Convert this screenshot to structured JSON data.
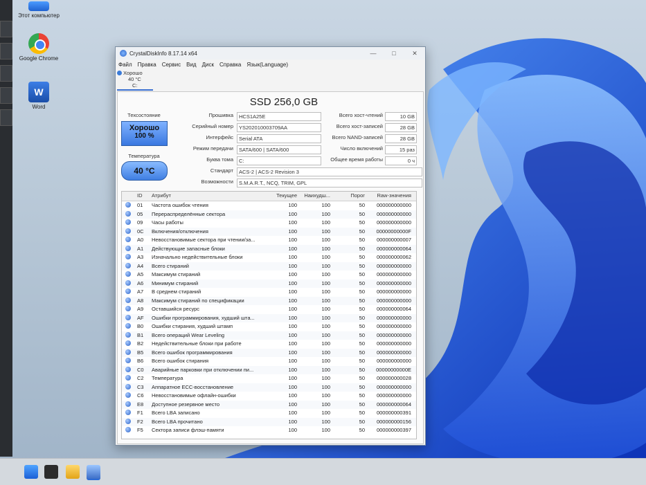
{
  "desktop": {
    "icons": [
      {
        "label": "Этот компьютер"
      },
      {
        "label": "Google Chrome"
      },
      {
        "label": "Word"
      }
    ]
  },
  "window": {
    "title": "CrystalDiskInfo 8.17.14 x64",
    "menu": [
      "Файл",
      "Правка",
      "Сервис",
      "Вид",
      "Диск",
      "Справка",
      "Язык(Language)"
    ],
    "disk_tab": {
      "status": "Хорошо",
      "temp": "40 °C",
      "letter": "C:"
    },
    "model": "SSD 256,0 GB",
    "health": {
      "caption": "Техсостояние",
      "status": "Хорошо",
      "percent": "100 %"
    },
    "temperature": {
      "caption": "Температура",
      "value": "40 °C"
    },
    "info": [
      {
        "label": "Прошивка",
        "value": "HCS1A25E"
      },
      {
        "label": "Серийный номер",
        "value": "YS202010003709AA"
      },
      {
        "label": "Интерфейс",
        "value": "Serial ATA"
      },
      {
        "label": "Режим передачи",
        "value": "SATA/600 | SATA/600"
      },
      {
        "label": "Буква тома",
        "value": "C:"
      }
    ],
    "standard": {
      "label": "Стандарт",
      "value": "ACS-2 | ACS-2 Revision 3"
    },
    "features": {
      "label": "Возможности",
      "value": "S.M.A.R.T., NCQ, TRIM, GPL"
    },
    "right_info": [
      {
        "label": "Всего хост-чтений",
        "value": "10 GB"
      },
      {
        "label": "Всего хост-записей",
        "value": "28 GB"
      },
      {
        "label": "Всего NAND-записей",
        "value": "28 GB"
      },
      {
        "label": "Число включений",
        "value": "15 раз"
      },
      {
        "label": "Общее время работы",
        "value": "0 ч"
      }
    ],
    "smart": {
      "headers": {
        "id": "ID",
        "attr": "Атрибут",
        "current": "Текущее",
        "worst": "Наихудш...",
        "threshold": "Порог",
        "raw": "Raw-значения"
      },
      "rows": [
        {
          "id": "01",
          "attr": "Частота ошибок чтения",
          "cur": "100",
          "worst": "100",
          "thr": "50",
          "raw": "000000000000"
        },
        {
          "id": "05",
          "attr": "Перераспределённые сектора",
          "cur": "100",
          "worst": "100",
          "thr": "50",
          "raw": "000000000000"
        },
        {
          "id": "09",
          "attr": "Часы работы",
          "cur": "100",
          "worst": "100",
          "thr": "50",
          "raw": "000000000000"
        },
        {
          "id": "0C",
          "attr": "Включения/отключения",
          "cur": "100",
          "worst": "100",
          "thr": "50",
          "raw": "00000000000F"
        },
        {
          "id": "A0",
          "attr": "Невосстановимые сектора при чтении/за...",
          "cur": "100",
          "worst": "100",
          "thr": "50",
          "raw": "000000000007"
        },
        {
          "id": "A1",
          "attr": "Действующие запасные блоки",
          "cur": "100",
          "worst": "100",
          "thr": "50",
          "raw": "000000000064"
        },
        {
          "id": "A3",
          "attr": "Изначально недействительные блоки",
          "cur": "100",
          "worst": "100",
          "thr": "50",
          "raw": "000000000062"
        },
        {
          "id": "A4",
          "attr": "Всего стираний",
          "cur": "100",
          "worst": "100",
          "thr": "50",
          "raw": "000000000000"
        },
        {
          "id": "A5",
          "attr": "Максимум стираний",
          "cur": "100",
          "worst": "100",
          "thr": "50",
          "raw": "000000000000"
        },
        {
          "id": "A6",
          "attr": "Минимум стираний",
          "cur": "100",
          "worst": "100",
          "thr": "50",
          "raw": "000000000000"
        },
        {
          "id": "A7",
          "attr": "В среднем стираний",
          "cur": "100",
          "worst": "100",
          "thr": "50",
          "raw": "000000000000"
        },
        {
          "id": "A8",
          "attr": "Максимум стираний по спецификации",
          "cur": "100",
          "worst": "100",
          "thr": "50",
          "raw": "000000000000"
        },
        {
          "id": "A9",
          "attr": "Оставшийся ресурс",
          "cur": "100",
          "worst": "100",
          "thr": "50",
          "raw": "000000000064"
        },
        {
          "id": "AF",
          "attr": "Ошибки программирования, худший шта...",
          "cur": "100",
          "worst": "100",
          "thr": "50",
          "raw": "000000000000"
        },
        {
          "id": "B0",
          "attr": "Ошибки стирания, худший штамп",
          "cur": "100",
          "worst": "100",
          "thr": "50",
          "raw": "000000000000"
        },
        {
          "id": "B1",
          "attr": "Всего операций Wear Leveling",
          "cur": "100",
          "worst": "100",
          "thr": "50",
          "raw": "000000000000"
        },
        {
          "id": "B2",
          "attr": "Недействительные блоки при работе",
          "cur": "100",
          "worst": "100",
          "thr": "50",
          "raw": "000000000000"
        },
        {
          "id": "B5",
          "attr": "Всего ошибок программирования",
          "cur": "100",
          "worst": "100",
          "thr": "50",
          "raw": "000000000000"
        },
        {
          "id": "B6",
          "attr": "Всего ошибок стирания",
          "cur": "100",
          "worst": "100",
          "thr": "50",
          "raw": "000000000000"
        },
        {
          "id": "C0",
          "attr": "Аварийные парковки при отключении пи...",
          "cur": "100",
          "worst": "100",
          "thr": "50",
          "raw": "00000000000E"
        },
        {
          "id": "C2",
          "attr": "Температура",
          "cur": "100",
          "worst": "100",
          "thr": "50",
          "raw": "000000000028"
        },
        {
          "id": "C3",
          "attr": "Аппаратное ECC-восстановление",
          "cur": "100",
          "worst": "100",
          "thr": "50",
          "raw": "000000000000"
        },
        {
          "id": "C6",
          "attr": "Невосстановимые офлайн-ошибки",
          "cur": "100",
          "worst": "100",
          "thr": "50",
          "raw": "000000000000"
        },
        {
          "id": "E8",
          "attr": "Доступное резервное место",
          "cur": "100",
          "worst": "100",
          "thr": "50",
          "raw": "000000000064"
        },
        {
          "id": "F1",
          "attr": "Всего LBA записано",
          "cur": "100",
          "worst": "100",
          "thr": "50",
          "raw": "000000000391"
        },
        {
          "id": "F2",
          "attr": "Всего LBA прочитано",
          "cur": "100",
          "worst": "100",
          "thr": "50",
          "raw": "000000000156"
        },
        {
          "id": "F5",
          "attr": "Сектора записи флэш-памяти",
          "cur": "100",
          "worst": "100",
          "thr": "50",
          "raw": "000000000397"
        }
      ]
    }
  },
  "colors": {
    "accent": "#3a78e0",
    "wallpaper_blue": "#1f5fe0"
  }
}
